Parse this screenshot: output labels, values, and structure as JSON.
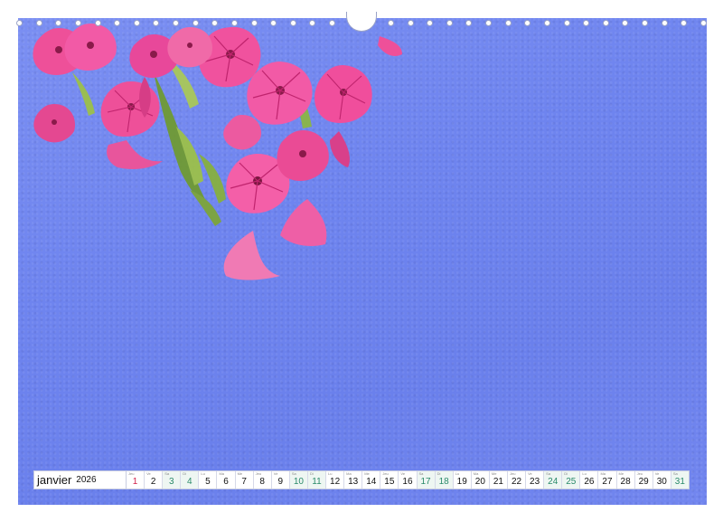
{
  "calendar": {
    "month": "janvier",
    "year": "2026",
    "days": [
      {
        "num": "1",
        "abbr": "Jeu",
        "type": "holiday"
      },
      {
        "num": "2",
        "abbr": "Ve",
        "type": "weekday"
      },
      {
        "num": "3",
        "abbr": "Sa",
        "type": "weekend"
      },
      {
        "num": "4",
        "abbr": "Di",
        "type": "weekend"
      },
      {
        "num": "5",
        "abbr": "Lu",
        "type": "weekday"
      },
      {
        "num": "6",
        "abbr": "Ma",
        "type": "weekday"
      },
      {
        "num": "7",
        "abbr": "Me",
        "type": "weekday"
      },
      {
        "num": "8",
        "abbr": "Jeu",
        "type": "weekday"
      },
      {
        "num": "9",
        "abbr": "Ve",
        "type": "weekday"
      },
      {
        "num": "10",
        "abbr": "Sa",
        "type": "weekend"
      },
      {
        "num": "11",
        "abbr": "Di",
        "type": "weekend"
      },
      {
        "num": "12",
        "abbr": "Lu",
        "type": "weekday"
      },
      {
        "num": "13",
        "abbr": "Ma",
        "type": "weekday"
      },
      {
        "num": "14",
        "abbr": "Me",
        "type": "weekday"
      },
      {
        "num": "15",
        "abbr": "Jeu",
        "type": "weekday"
      },
      {
        "num": "16",
        "abbr": "Ve",
        "type": "weekday"
      },
      {
        "num": "17",
        "abbr": "Sa",
        "type": "weekend"
      },
      {
        "num": "18",
        "abbr": "Di",
        "type": "weekend"
      },
      {
        "num": "19",
        "abbr": "Lu",
        "type": "weekday"
      },
      {
        "num": "20",
        "abbr": "Ma",
        "type": "weekday"
      },
      {
        "num": "21",
        "abbr": "Me",
        "type": "weekday"
      },
      {
        "num": "22",
        "abbr": "Jeu",
        "type": "weekday"
      },
      {
        "num": "23",
        "abbr": "Ve",
        "type": "weekday"
      },
      {
        "num": "24",
        "abbr": "Sa",
        "type": "weekend"
      },
      {
        "num": "25",
        "abbr": "Di",
        "type": "weekend"
      },
      {
        "num": "26",
        "abbr": "Lu",
        "type": "weekday"
      },
      {
        "num": "27",
        "abbr": "Ma",
        "type": "weekday"
      },
      {
        "num": "28",
        "abbr": "Me",
        "type": "weekday"
      },
      {
        "num": "29",
        "abbr": "Jeu",
        "type": "weekday"
      },
      {
        "num": "30",
        "abbr": "Ve",
        "type": "weekday"
      },
      {
        "num": "31",
        "abbr": "Sa",
        "type": "weekend"
      }
    ]
  },
  "colors": {
    "wall": "#6e84ef",
    "flower": "#f0529e",
    "flower_dark": "#c0246e",
    "leaf": "#7da53a",
    "weekend_text": "#2a8a6a",
    "holiday_text": "#d0204a"
  },
  "binding": {
    "hole_count": 36,
    "hanger_icon": "calendar-hanger-icon"
  }
}
